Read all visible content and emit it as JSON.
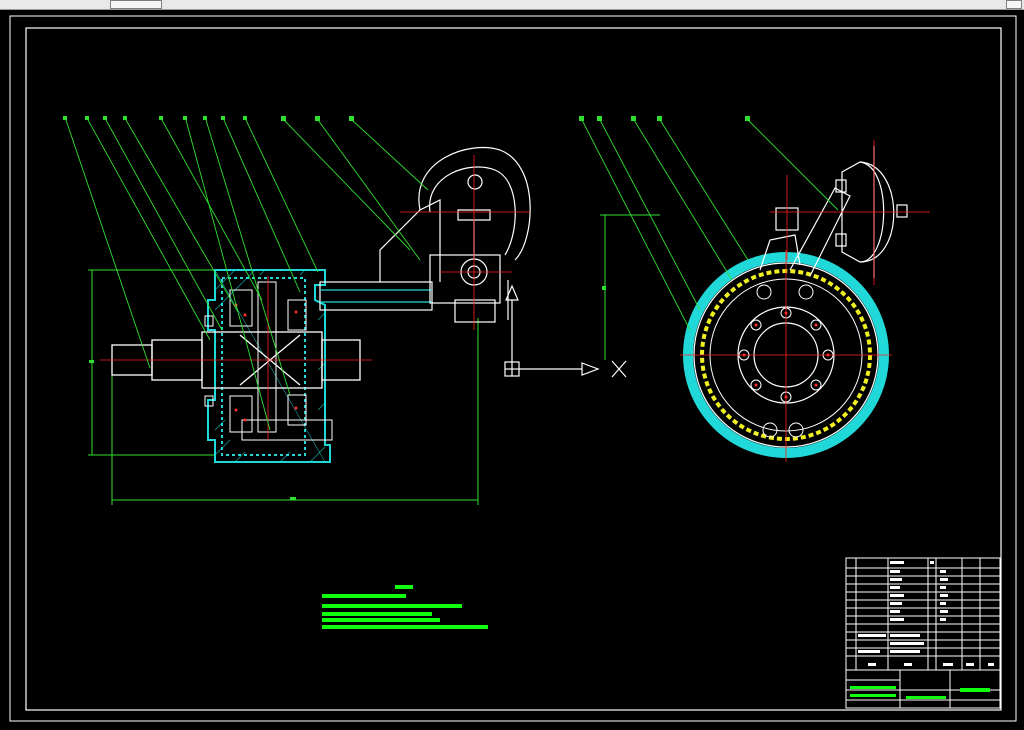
{
  "colors": {
    "background": "#000000",
    "frame": "#ffffff",
    "leader": "#30e030",
    "centerline": "#ff2020",
    "hatch": "#20d8d8",
    "lining": "#f0f020",
    "tech_text": "#10ff10",
    "part": "#ffffff"
  },
  "icons": {
    "view_arrow": "arrow-icon",
    "section_symbol": "section-cross-icon"
  },
  "drawing": {
    "left_view_balloons": [
      "1",
      "2",
      "3",
      "4",
      "5",
      "6",
      "7",
      "8",
      "9"
    ],
    "right_view_balloons": [
      "1",
      "2",
      "3",
      "4",
      "5"
    ]
  }
}
